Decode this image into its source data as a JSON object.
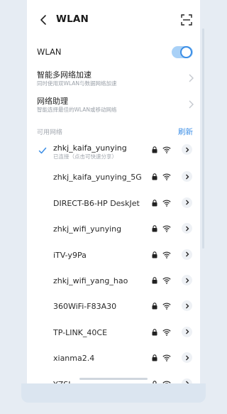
{
  "header": {
    "title": "WLAN",
    "back_icon": "back-arrow-icon",
    "scan_icon": "scan-icon"
  },
  "wlan_toggle": {
    "label": "WLAN",
    "on": true
  },
  "settings": [
    {
      "title": "智能多网络加速",
      "subtitle": "同时使用双WLAN与数据网络加速"
    },
    {
      "title": "网络助理",
      "subtitle": "智能选择最佳的WLAN或移动网络"
    }
  ],
  "section": {
    "label": "可用网络",
    "refresh": "刷新"
  },
  "networks": [
    {
      "ssid": "zhkj_kaifa_yunying",
      "status": "已连接（点击可快速分享）",
      "connected": true
    },
    {
      "ssid": "zhkj_kaifa_yunying_5G"
    },
    {
      "ssid": "DIRECT-B6-HP DeskJet"
    },
    {
      "ssid": "zhkj_wifi_yunying"
    },
    {
      "ssid": "iTV-y9Pa"
    },
    {
      "ssid": "zhkj_wifi_yang_hao"
    },
    {
      "ssid": "360WiFi-F83A30"
    },
    {
      "ssid": "TP-LINK_40CE"
    },
    {
      "ssid": "xianma2.4"
    },
    {
      "ssid": "YZSL"
    }
  ],
  "colors": {
    "accent": "#3b8ee6",
    "background": "#e6ecf3"
  }
}
